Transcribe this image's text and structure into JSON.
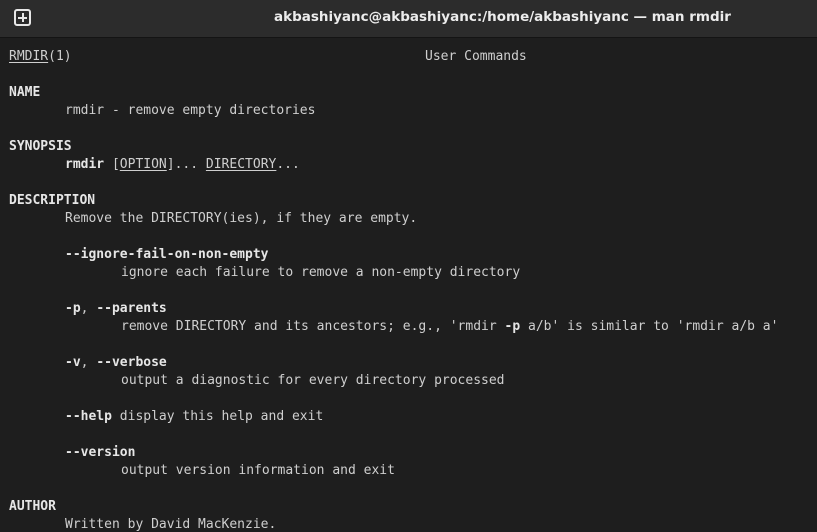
{
  "window": {
    "title": "akbashiyanc@akbashiyanc:/home/akbashiyanc — man rmdir",
    "new_tab_icon": "plus-square-icon"
  },
  "man": {
    "header_left": "RMDIR",
    "header_left_section": "(1)",
    "header_center": "User Commands",
    "name_heading": "NAME",
    "name_text": "rmdir - remove empty directories",
    "synopsis_heading": "SYNOPSIS",
    "synopsis_cmd": "rmdir",
    "synopsis_open_bracket": " [",
    "synopsis_option": "OPTION",
    "synopsis_close": "]... ",
    "synopsis_directory": "DIRECTORY",
    "synopsis_ellipsis": "...",
    "description_heading": "DESCRIPTION",
    "description_text": "Remove the DIRECTORY(ies), if they are empty.",
    "opt_ignore": "--ignore-fail-on-non-empty",
    "opt_ignore_desc": "ignore each failure to remove a non-empty directory",
    "opt_parents_short": "-p",
    "opt_sep1": ", ",
    "opt_parents_long": "--parents",
    "opt_parents_desc_a": "remove DIRECTORY and its ancestors; e.g., 'rmdir ",
    "opt_parents_desc_flag": "-p",
    "opt_parents_desc_b": " a/b' is similar to 'rmdir a/b a'",
    "opt_verbose_short": "-v",
    "opt_sep2": ", ",
    "opt_verbose_long": "--verbose",
    "opt_verbose_desc": "output a diagnostic for every directory processed",
    "opt_help": "--help",
    "opt_help_desc": " display this help and exit",
    "opt_version": "--version",
    "opt_version_desc": "output version information and exit",
    "author_heading": "AUTHOR",
    "author_text": "Written by David MacKenzie."
  }
}
